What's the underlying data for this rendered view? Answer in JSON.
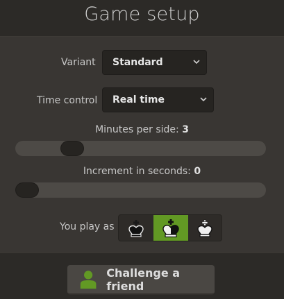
{
  "header": {
    "title": "Game setup"
  },
  "variant": {
    "label": "Variant",
    "value": "Standard"
  },
  "time_control": {
    "label": "Time control",
    "value": "Real time"
  },
  "minutes": {
    "label": "Minutes per side:",
    "value": "3",
    "level": 0.2
  },
  "increment": {
    "label": "Increment in seconds:",
    "value": "0",
    "level": 0.0
  },
  "color_choice": {
    "label": "You play as",
    "options": [
      "black-king-icon",
      "random-king-icon",
      "white-king-icon"
    ],
    "selected": "random-king-icon"
  },
  "footer": {
    "challenge_label": "Challenge a friend",
    "accent": "#629924"
  },
  "colors": {
    "accent_green": "#629924",
    "icon_green": "#629924"
  }
}
